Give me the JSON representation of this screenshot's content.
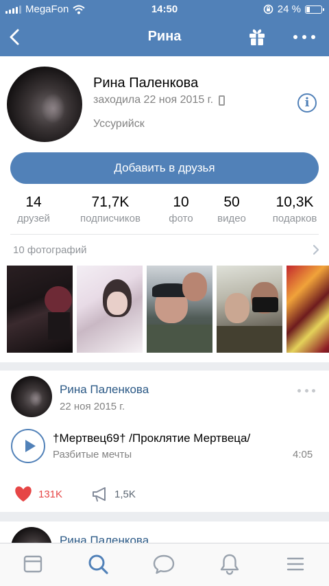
{
  "status_bar": {
    "carrier": "MegaFon",
    "time": "14:50",
    "battery_percent": "24 %",
    "battery_level": 0.24
  },
  "nav": {
    "title": "Рина",
    "back_icon": "chevron-left-icon",
    "gift_icon": "gift-icon",
    "more_icon": "more-dots-icon"
  },
  "profile": {
    "name": "Рина Паленкова",
    "last_seen": "заходила 22 ноя 2015 г.",
    "city": "Уссурийск",
    "info_glyph": "i",
    "add_friend_label": "Добавить в друзья",
    "counters": [
      {
        "value": "14",
        "label": "друзей"
      },
      {
        "value": "71,7K",
        "label": "подписчиков"
      },
      {
        "value": "10",
        "label": "фото"
      },
      {
        "value": "50",
        "label": "видео"
      },
      {
        "value": "10,3K",
        "label": "подарков"
      }
    ],
    "photos_header": "10 фотографий"
  },
  "post": {
    "author": "Рина Паленкова",
    "date": "22 ноя 2015 г.",
    "audio": {
      "title": "†Мертвец69† /Проклятие Мертвеца/",
      "artist": "Разбитые мечты",
      "duration": "4:05"
    },
    "likes": "131K",
    "shares": "1,5K"
  },
  "post2": {
    "author": "Рина Паленкова"
  },
  "tabbar": [
    "news-feed-icon",
    "search-icon",
    "messages-icon",
    "notifications-icon",
    "menu-icon"
  ],
  "colors": {
    "brand": "#5181b8",
    "link": "#2a5885",
    "like": "#e64646",
    "secondary_text": "#828282"
  }
}
